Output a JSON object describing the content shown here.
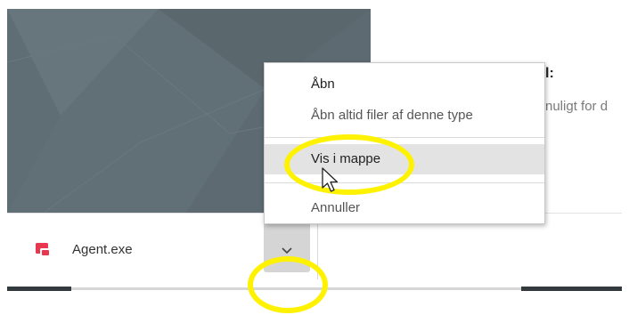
{
  "page": {
    "heading_fragment": "l:",
    "line_fragment": "nuligt for d"
  },
  "download": {
    "file_name": "Agent.exe",
    "icon": "app-file-icon",
    "dropdown_icon": "chevron-down-icon"
  },
  "context_menu": {
    "items": [
      {
        "label": "Åbn"
      },
      {
        "label": "Åbn altid filer af denne type"
      },
      {
        "label": "Vis i mappe",
        "highlighted": true
      },
      {
        "label": "Annuller"
      }
    ]
  },
  "colors": {
    "highlight_ring": "#fff200",
    "panel": "#5f6d74",
    "menu_hover": "#e3e3e3",
    "file_icon": "#e8384f"
  },
  "cursor": {
    "icon": "arrow-cursor-icon"
  }
}
